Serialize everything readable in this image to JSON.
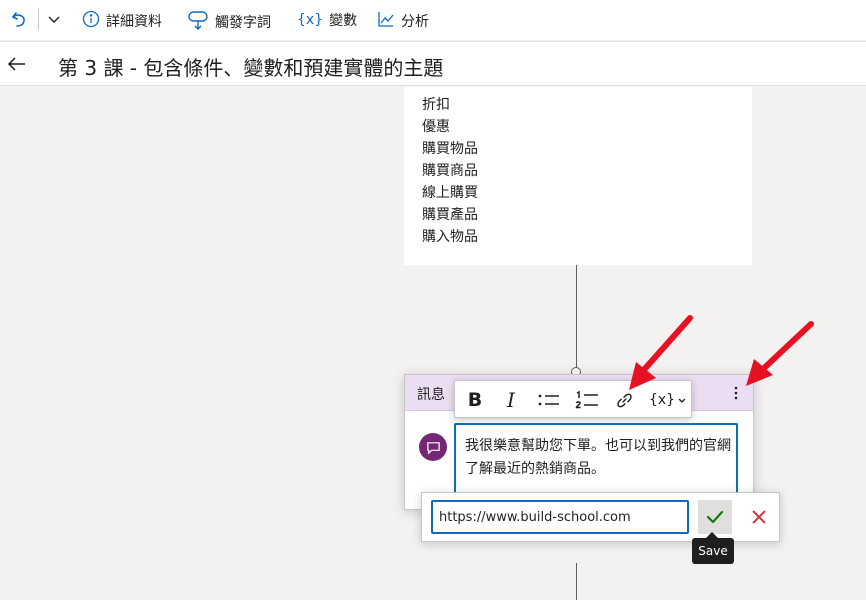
{
  "toolbar": {
    "details_label": "詳細資料",
    "trigger_label": "觸發字詞",
    "variables_icon_text": "{x}",
    "variables_label": "變數",
    "analytics_label": "分析"
  },
  "header": {
    "title": "第 3 課 - 包含條件、變數和預建實體的主題"
  },
  "trigger_phrases": [
    "折扣",
    "優惠",
    "購買物品",
    "購買商品",
    "線上購買",
    "購買產品",
    "購入物品"
  ],
  "message_node": {
    "label": "訊息",
    "text": "我很樂意幫助您下單。也可以到我們的官網了解最近的熱銷商品。"
  },
  "format_toolbar": {
    "bold": "B",
    "italic": "I",
    "variable": "{x}"
  },
  "link_editor": {
    "url_value": "https://www.build-school.com",
    "confirm_tooltip": "Save"
  },
  "colors": {
    "accent": "#0f6cbd",
    "message_header": "#ecdef2",
    "message_icon": "#742774",
    "confirm_check": "#107c10",
    "cancel_x": "#d13438",
    "annotation_arrow": "#e81123"
  },
  "icons": {
    "undo": "undo-icon",
    "details": "info-icon",
    "trigger": "trigger-icon",
    "analytics": "chart-icon",
    "back": "back-arrow-icon",
    "more": "more-vertical-icon",
    "link": "link-icon",
    "message": "chat-bubble-icon",
    "confirm": "checkmark-icon",
    "cancel": "close-icon"
  }
}
